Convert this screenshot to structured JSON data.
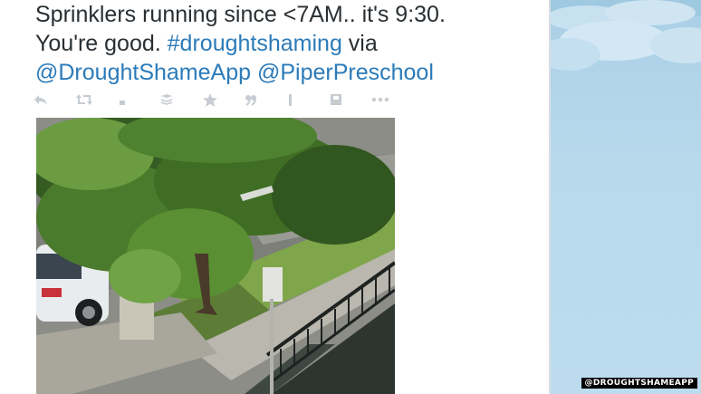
{
  "tweet": {
    "text_line1": "Sprinklers running since <7AM.. it's 9:30.",
    "text_line2_plain": "You're good. ",
    "hashtag": "#droughtshaming",
    "text_line2_tail": " via",
    "mention1": "@DroughtShameApp",
    "mention2": "@PiperPreschool"
  },
  "actions": [
    {
      "name": "reply-icon",
      "glyph": "↩"
    },
    {
      "name": "retweet-icon",
      "glyph": "⇄"
    },
    {
      "name": "small-dot-icon",
      "glyph": "▪"
    },
    {
      "name": "stack-icon",
      "glyph": "≋"
    },
    {
      "name": "favorite-icon",
      "glyph": "★"
    },
    {
      "name": "quote-icon",
      "glyph": "❞"
    },
    {
      "name": "pin-icon",
      "glyph": "ǀ"
    },
    {
      "name": "save-icon",
      "glyph": "▣"
    },
    {
      "name": "more-icon",
      "glyph": "•••"
    }
  ],
  "watermark": "@DROUGHTSHAMEAPP",
  "colors": {
    "text": "#292f33",
    "link": "#2b7bb9",
    "action_icon": "#c6ccd1",
    "sidebar_sky": "#b8d9ec"
  }
}
